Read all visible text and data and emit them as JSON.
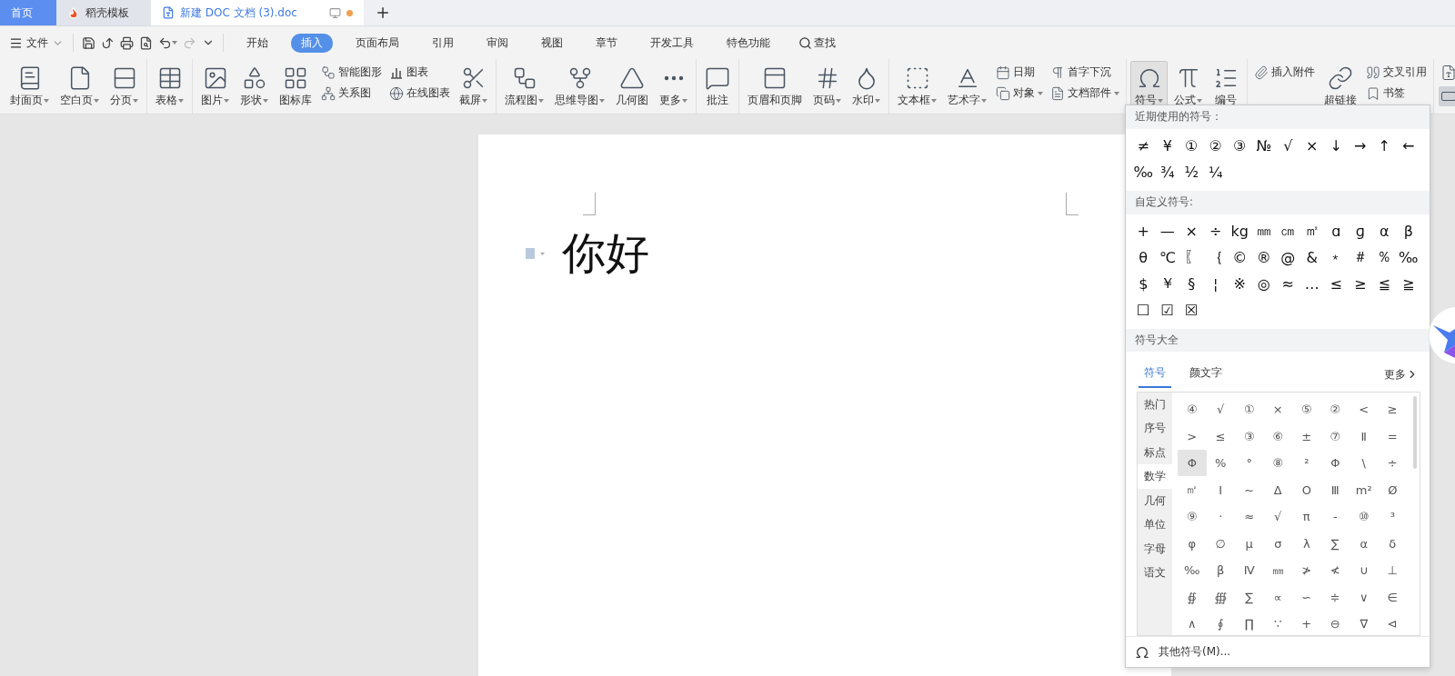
{
  "tabs": [
    {
      "kind": "home",
      "label": "首页",
      "selected": false
    },
    {
      "kind": "docer",
      "label": "稻壳模板",
      "selected": false
    },
    {
      "kind": "doc",
      "label": "新建 DOC 文档 (3).doc",
      "selected": true,
      "unsaved": true
    }
  ],
  "menu": {
    "file": "文件",
    "ribbon_tabs": [
      {
        "label": "开始",
        "selected": false
      },
      {
        "label": "插入",
        "selected": true
      },
      {
        "label": "页面布局",
        "selected": false
      },
      {
        "label": "引用",
        "selected": false
      },
      {
        "label": "审阅",
        "selected": false
      },
      {
        "label": "视图",
        "selected": false
      },
      {
        "label": "章节",
        "selected": false
      },
      {
        "label": "开发工具",
        "selected": false
      },
      {
        "label": "特色功能",
        "selected": false
      }
    ],
    "search": "查找"
  },
  "ribbon": {
    "groups": [
      {
        "items": [
          {
            "kind": "big",
            "label": "封面页",
            "dropdown": true,
            "pressed": false
          },
          {
            "kind": "big",
            "label": "空白页",
            "dropdown": true,
            "pressed": false
          },
          {
            "kind": "big",
            "label": "分页",
            "dropdown": true,
            "pressed": false
          }
        ]
      },
      {
        "items": [
          {
            "kind": "big",
            "label": "表格",
            "dropdown": true,
            "pressed": false
          }
        ]
      },
      {
        "items": [
          {
            "kind": "big",
            "label": "图片",
            "dropdown": true,
            "pressed": false
          },
          {
            "kind": "big",
            "label": "形状",
            "dropdown": true,
            "pressed": false
          },
          {
            "kind": "big",
            "label": "图标库",
            "dropdown": false,
            "pressed": false
          },
          {
            "kind": "pair",
            "items": [
              {
                "label": "智能图形",
                "dropdown": false
              },
              {
                "label": "关系图",
                "dropdown": false
              }
            ]
          },
          {
            "kind": "pair",
            "items": [
              {
                "label": "图表",
                "dropdown": false
              },
              {
                "label": "在线图表",
                "dropdown": false
              }
            ]
          },
          {
            "kind": "big",
            "label": "截屏",
            "dropdown": true,
            "pressed": false
          }
        ]
      },
      {
        "items": [
          {
            "kind": "big",
            "label": "流程图",
            "dropdown": true,
            "pressed": false
          },
          {
            "kind": "big",
            "label": "思维导图",
            "dropdown": true,
            "pressed": false
          },
          {
            "kind": "big",
            "label": "几何图",
            "dropdown": false,
            "pressed": false
          },
          {
            "kind": "big",
            "label": "更多",
            "dropdown": true,
            "pressed": false
          }
        ]
      },
      {
        "items": [
          {
            "kind": "big",
            "label": "批注",
            "dropdown": false,
            "pressed": false
          }
        ]
      },
      {
        "items": [
          {
            "kind": "big",
            "label": "页眉和页脚",
            "dropdown": false,
            "pressed": false
          },
          {
            "kind": "big",
            "label": "页码",
            "dropdown": true,
            "pressed": false
          },
          {
            "kind": "big",
            "label": "水印",
            "dropdown": true,
            "pressed": false
          }
        ]
      },
      {
        "items": [
          {
            "kind": "big",
            "label": "文本框",
            "dropdown": true,
            "pressed": false
          },
          {
            "kind": "big",
            "label": "艺术字",
            "dropdown": true,
            "pressed": false
          },
          {
            "kind": "pair",
            "items": [
              {
                "label": "日期",
                "dropdown": false
              },
              {
                "label": "对象",
                "dropdown": true
              }
            ]
          },
          {
            "kind": "pair",
            "items": [
              {
                "label": "首字下沉",
                "dropdown": false
              },
              {
                "label": "文档部件",
                "dropdown": true
              }
            ]
          }
        ]
      },
      {
        "items": [
          {
            "kind": "big",
            "label": "符号",
            "dropdown": true,
            "pressed": true
          },
          {
            "kind": "big",
            "label": "公式",
            "dropdown": true,
            "pressed": false
          },
          {
            "kind": "big",
            "label": "编号",
            "dropdown": false,
            "pressed": false
          }
        ]
      },
      {
        "items": [
          {
            "kind": "pair",
            "items": [
              {
                "label": "插入附件",
                "dropdown": false
              }
            ]
          },
          {
            "kind": "big",
            "label": "超链接",
            "dropdown": false,
            "pressed": false
          },
          {
            "kind": "pair",
            "items": [
              {
                "label": "交叉引用",
                "dropdown": false
              },
              {
                "label": "书签",
                "dropdown": false
              }
            ]
          }
        ]
      },
      {
        "items": [
          {
            "kind": "icons",
            "buttons": [
              {
                "pressed": false
              },
              {
                "pressed": true
              }
            ]
          }
        ]
      }
    ]
  },
  "document": {
    "text": "你好"
  },
  "symbol_menu": {
    "recent": {
      "title": "近期使用的符号：",
      "symbols": [
        "≠",
        "¥",
        "①",
        "②",
        "③",
        "№",
        "√",
        "×",
        "↓",
        "→",
        "↑",
        "←",
        "‰",
        "¾",
        "½",
        "¼"
      ]
    },
    "custom": {
      "title": "自定义符号:",
      "symbols": [
        "+",
        "—",
        "×",
        "÷",
        "kg",
        "㎜",
        "㎝",
        "㎡",
        "ɑ",
        "ɡ",
        "α",
        "β",
        "θ",
        "℃",
        "〖",
        "｛",
        "©",
        "®",
        "@",
        "&",
        "﹡",
        "＃",
        "％",
        "‰",
        "$",
        "￥",
        "§",
        "¦",
        "※",
        "◎",
        "≈",
        "…",
        "≤",
        "≥",
        "≦",
        "≧",
        "☐",
        "☑",
        "☒"
      ]
    },
    "all": {
      "title": "符号大全",
      "tabs": [
        {
          "label": "符号",
          "selected": true
        },
        {
          "label": "颜文字",
          "selected": false
        }
      ],
      "more": "更多",
      "categories": [
        {
          "label": "热门",
          "selected": false
        },
        {
          "label": "序号",
          "selected": false
        },
        {
          "label": "标点",
          "selected": false
        },
        {
          "label": "数学",
          "selected": true
        },
        {
          "label": "几何",
          "selected": false
        },
        {
          "label": "单位",
          "selected": false
        },
        {
          "label": "字母",
          "selected": false
        },
        {
          "label": "语文",
          "selected": false
        }
      ],
      "symbols": [
        {
          "s": "④",
          "selected": false
        },
        {
          "s": "√",
          "selected": false
        },
        {
          "s": "①",
          "selected": false
        },
        {
          "s": "×",
          "selected": false
        },
        {
          "s": "⑤",
          "selected": false
        },
        {
          "s": "②",
          "selected": false
        },
        {
          "s": "<",
          "selected": false
        },
        {
          "s": "≥",
          "selected": false
        },
        {
          "s": ">",
          "selected": false
        },
        {
          "s": "≤",
          "selected": false
        },
        {
          "s": "③",
          "selected": false
        },
        {
          "s": "⑥",
          "selected": false
        },
        {
          "s": "±",
          "selected": false
        },
        {
          "s": "⑦",
          "selected": false
        },
        {
          "s": "Ⅱ",
          "selected": false
        },
        {
          "s": "=",
          "selected": false
        },
        {
          "s": "Φ",
          "selected": true
        },
        {
          "s": "%",
          "selected": false
        },
        {
          "s": "°",
          "selected": false
        },
        {
          "s": "⑧",
          "selected": false
        },
        {
          "s": "²",
          "selected": false
        },
        {
          "s": "Φ",
          "selected": false
        },
        {
          "s": "\\",
          "selected": false
        },
        {
          "s": "÷",
          "selected": false
        },
        {
          "s": "㎡",
          "selected": false
        },
        {
          "s": "Ⅰ",
          "selected": false
        },
        {
          "s": "~",
          "selected": false
        },
        {
          "s": "Δ",
          "selected": false
        },
        {
          "s": "O",
          "selected": false
        },
        {
          "s": "Ⅲ",
          "selected": false
        },
        {
          "s": "m²",
          "selected": false
        },
        {
          "s": "Ø",
          "selected": false
        },
        {
          "s": "⑨",
          "selected": false
        },
        {
          "s": "·",
          "selected": false
        },
        {
          "s": "≈",
          "selected": false
        },
        {
          "s": "√",
          "selected": false
        },
        {
          "s": "π",
          "selected": false
        },
        {
          "s": "-",
          "selected": false
        },
        {
          "s": "⑩",
          "selected": false
        },
        {
          "s": "³",
          "selected": false
        },
        {
          "s": "φ",
          "selected": false
        },
        {
          "s": "∅",
          "selected": false
        },
        {
          "s": "μ",
          "selected": false
        },
        {
          "s": "σ",
          "selected": false
        },
        {
          "s": "λ",
          "selected": false
        },
        {
          "s": "∑",
          "selected": false
        },
        {
          "s": "α",
          "selected": false
        },
        {
          "s": "δ",
          "selected": false
        },
        {
          "s": "‰",
          "selected": false
        },
        {
          "s": "β",
          "selected": false
        },
        {
          "s": "Ⅳ",
          "selected": false
        },
        {
          "s": "㎜",
          "selected": false
        },
        {
          "s": "≯",
          "selected": false
        },
        {
          "s": "≮",
          "selected": false
        },
        {
          "s": "∪",
          "selected": false
        },
        {
          "s": "⊥",
          "selected": false
        },
        {
          "s": "∯",
          "selected": false
        },
        {
          "s": "∰",
          "selected": false
        },
        {
          "s": "∑",
          "selected": false
        },
        {
          "s": "∝",
          "selected": false
        },
        {
          "s": "∽",
          "selected": false
        },
        {
          "s": "≑",
          "selected": false
        },
        {
          "s": "∨",
          "selected": false
        },
        {
          "s": "∈",
          "selected": false
        },
        {
          "s": "∧",
          "selected": false
        },
        {
          "s": "∮",
          "selected": false
        },
        {
          "s": "∏",
          "selected": false
        },
        {
          "s": "∵",
          "selected": false
        },
        {
          "s": "+",
          "selected": false
        },
        {
          "s": "⊖",
          "selected": false
        },
        {
          "s": "∇",
          "selected": false
        },
        {
          "s": "⊲",
          "selected": false
        }
      ]
    },
    "footer": "其他符号(M)..."
  }
}
